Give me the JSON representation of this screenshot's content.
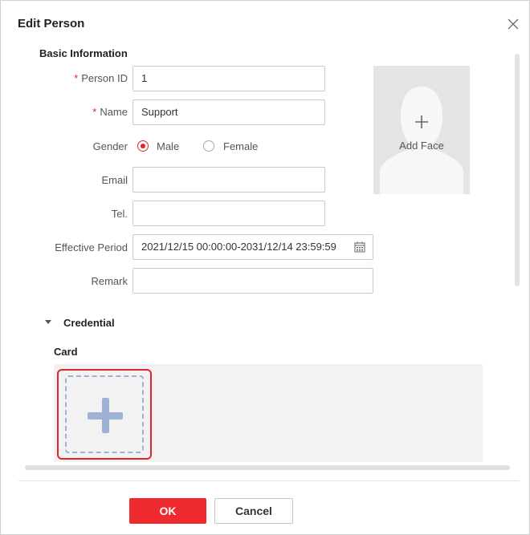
{
  "dialog": {
    "title": "Edit Person"
  },
  "basic": {
    "section_title": "Basic Information",
    "person_id": {
      "label": "Person ID",
      "required_mark": "*",
      "value": "1"
    },
    "name": {
      "label": "Name",
      "required_mark": "*",
      "value": "Support"
    },
    "gender": {
      "label": "Gender",
      "options": [
        "Male",
        "Female"
      ],
      "selected": "Male"
    },
    "email": {
      "label": "Email",
      "value": ""
    },
    "tel": {
      "label": "Tel.",
      "value": ""
    },
    "effective_period": {
      "label": "Effective Period",
      "value": "2021/12/15 00:00:00-2031/12/14 23:59:59"
    },
    "remark": {
      "label": "Remark",
      "value": ""
    },
    "face": {
      "label": "Add Face"
    }
  },
  "credential": {
    "section_title": "Credential",
    "card_title": "Card"
  },
  "footer": {
    "ok_label": "OK",
    "cancel_label": "Cancel"
  },
  "colors": {
    "accent": "#ee2a2f",
    "required": "#e0252d",
    "placeholder_bg": "#e4e4e4"
  }
}
